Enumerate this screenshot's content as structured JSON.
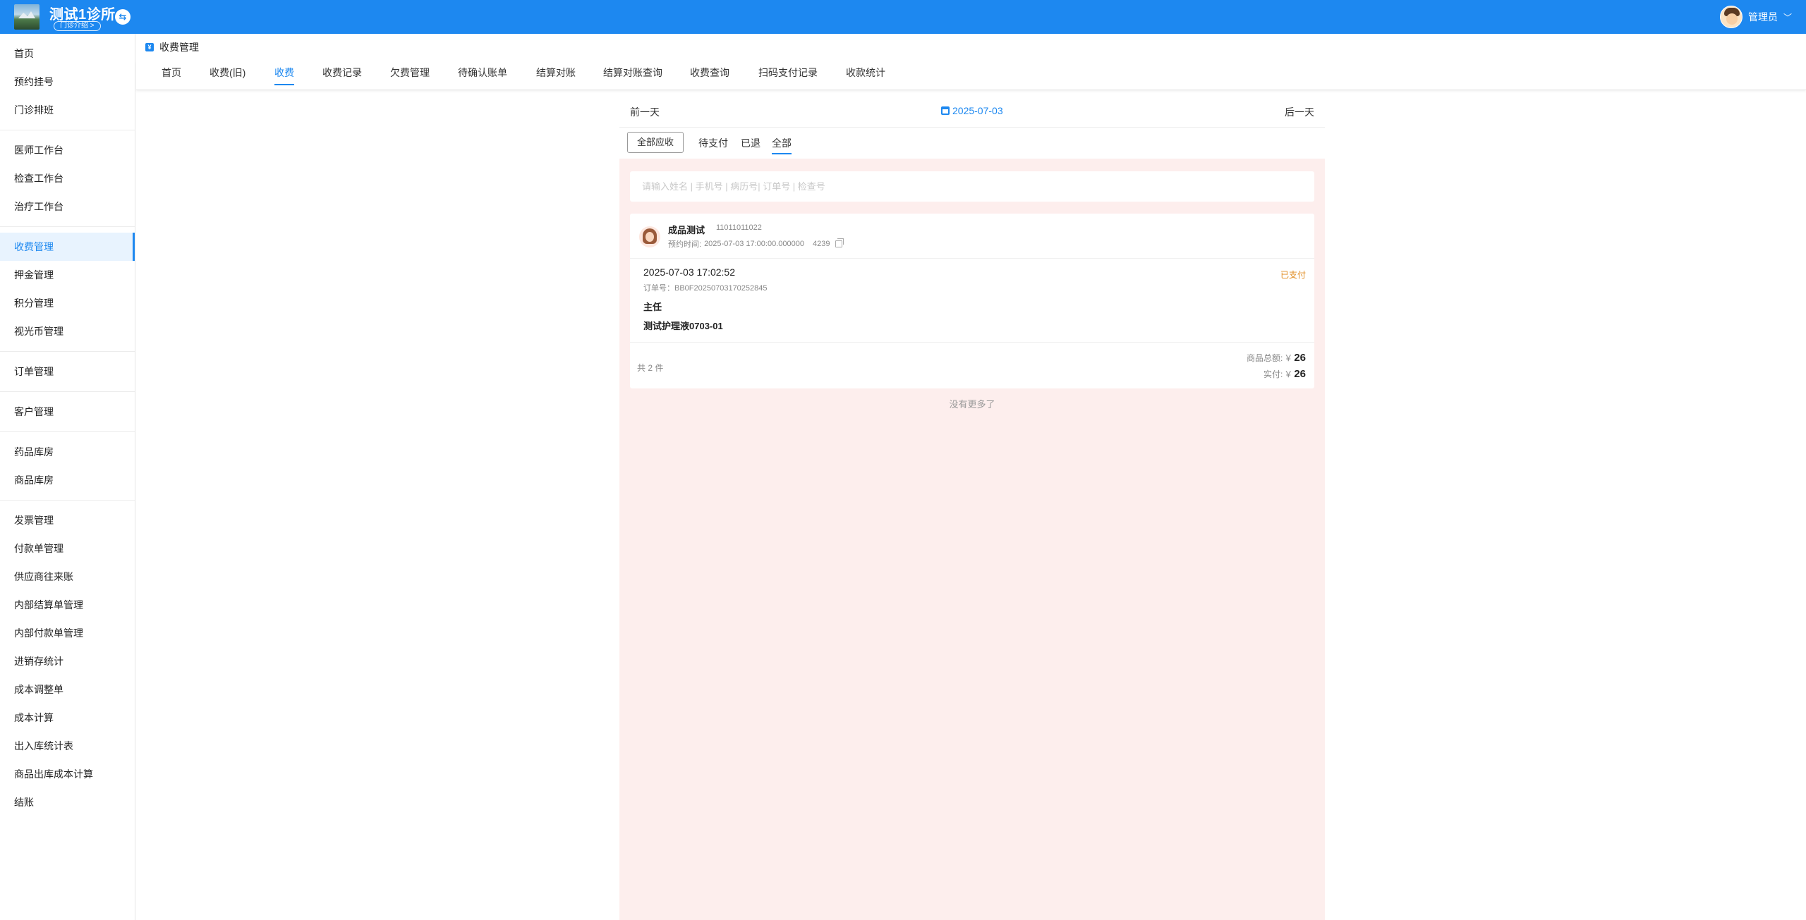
{
  "header": {
    "clinic_name": "测试1诊所",
    "clinic_intro": "门诊介绍 >",
    "user_name": "管理员"
  },
  "sidebar": {
    "groups": [
      [
        "首页",
        "预约挂号",
        "门诊排班"
      ],
      [
        "医师工作台",
        "检查工作台",
        "治疗工作台"
      ],
      [
        "收费管理",
        "押金管理",
        "积分管理",
        "视光币管理"
      ],
      [
        "订单管理"
      ],
      [
        "客户管理"
      ],
      [
        "药品库房",
        "商品库房"
      ],
      [
        "发票管理",
        "付款单管理",
        "供应商往来账",
        "内部结算单管理",
        "内部付款单管理",
        "进销存统计",
        "成本调整单",
        "成本计算",
        "出入库统计表",
        "商品出库成本计算",
        "结账"
      ]
    ],
    "active": "收费管理"
  },
  "breadcrumb": {
    "title": "收费管理"
  },
  "tabs": {
    "items": [
      "首页",
      "收费(旧)",
      "收费",
      "收费记录",
      "欠费管理",
      "待确认账单",
      "结算对账",
      "结算对账查询",
      "收费查询",
      "扫码支付记录",
      "收款统计"
    ],
    "active": "收费"
  },
  "datebar": {
    "prev": "前一天",
    "date": "2025-07-03",
    "next": "后一天"
  },
  "filters": {
    "all_due": "全部应收",
    "pending": "待支付",
    "refunded": "已退",
    "all": "全部",
    "active": "全部"
  },
  "search": {
    "placeholder": "请输入姓名 | 手机号 | 病历号| 订单号 | 检查号"
  },
  "order": {
    "patient_name": "成品测试",
    "patient_phone": "11011011022",
    "appt_label": "预约时间:",
    "appt_time": "2025-07-03 17:00:00.000000",
    "appt_code": "4239",
    "time": "2025-07-03 17:02:52",
    "status": "已支付",
    "status_color": "#e08a1e",
    "order_no": "订单号：BB0F20250703170252845",
    "doctor": "主任",
    "item": "测试护理液0703-01",
    "count": "共 2 件",
    "goods_total_label": "商品总额:",
    "goods_total_currency": "￥",
    "goods_total": "26",
    "paid_label": "实付:",
    "paid_currency": "￥",
    "paid": "26"
  },
  "footer": {
    "no_more": "没有更多了"
  },
  "colors": {
    "primary": "#1d88f0",
    "panel_bg": "#fdeeed"
  }
}
